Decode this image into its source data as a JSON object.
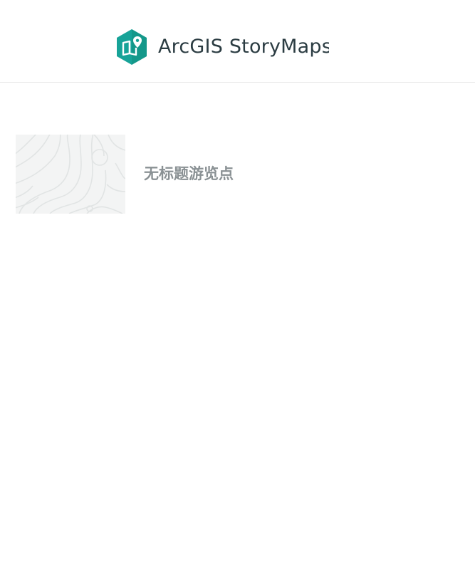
{
  "header": {
    "logo_icon": "storymaps-logo-icon",
    "brand_name": "ArcGIS StoryMaps",
    "brand_color": "#17a398"
  },
  "tours": [
    {
      "thumbnail_icon": "topographic-placeholder-icon",
      "title": "无标题游览点"
    }
  ]
}
